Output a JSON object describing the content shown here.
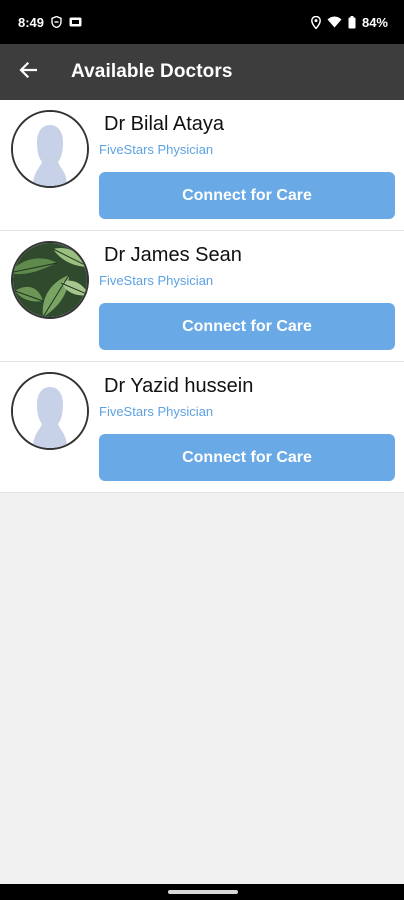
{
  "status_bar": {
    "time": "8:49",
    "battery": "84%",
    "icons": [
      "shield-icon",
      "sim-card-icon",
      "location-icon",
      "wifi-icon",
      "battery-icon"
    ]
  },
  "app_bar": {
    "title": "Available Doctors",
    "back_icon": "arrow-left-icon"
  },
  "doctors": [
    {
      "name": "Dr Bilal Ataya",
      "subtitle": "FiveStars Physician",
      "button": "Connect for Care",
      "avatar": "placeholder-silhouette"
    },
    {
      "name": "Dr James Sean",
      "subtitle": "FiveStars Physician",
      "button": "Connect for Care",
      "avatar": "leaf-photo"
    },
    {
      "name": "Dr Yazid hussein",
      "subtitle": "FiveStars Physician",
      "button": "Connect for Care",
      "avatar": "placeholder-silhouette"
    }
  ],
  "colors": {
    "app_bar": "#3d3d3d",
    "button": "#69a9e6",
    "subtitle": "#5ea2e3",
    "background": "#f1f1f1"
  }
}
